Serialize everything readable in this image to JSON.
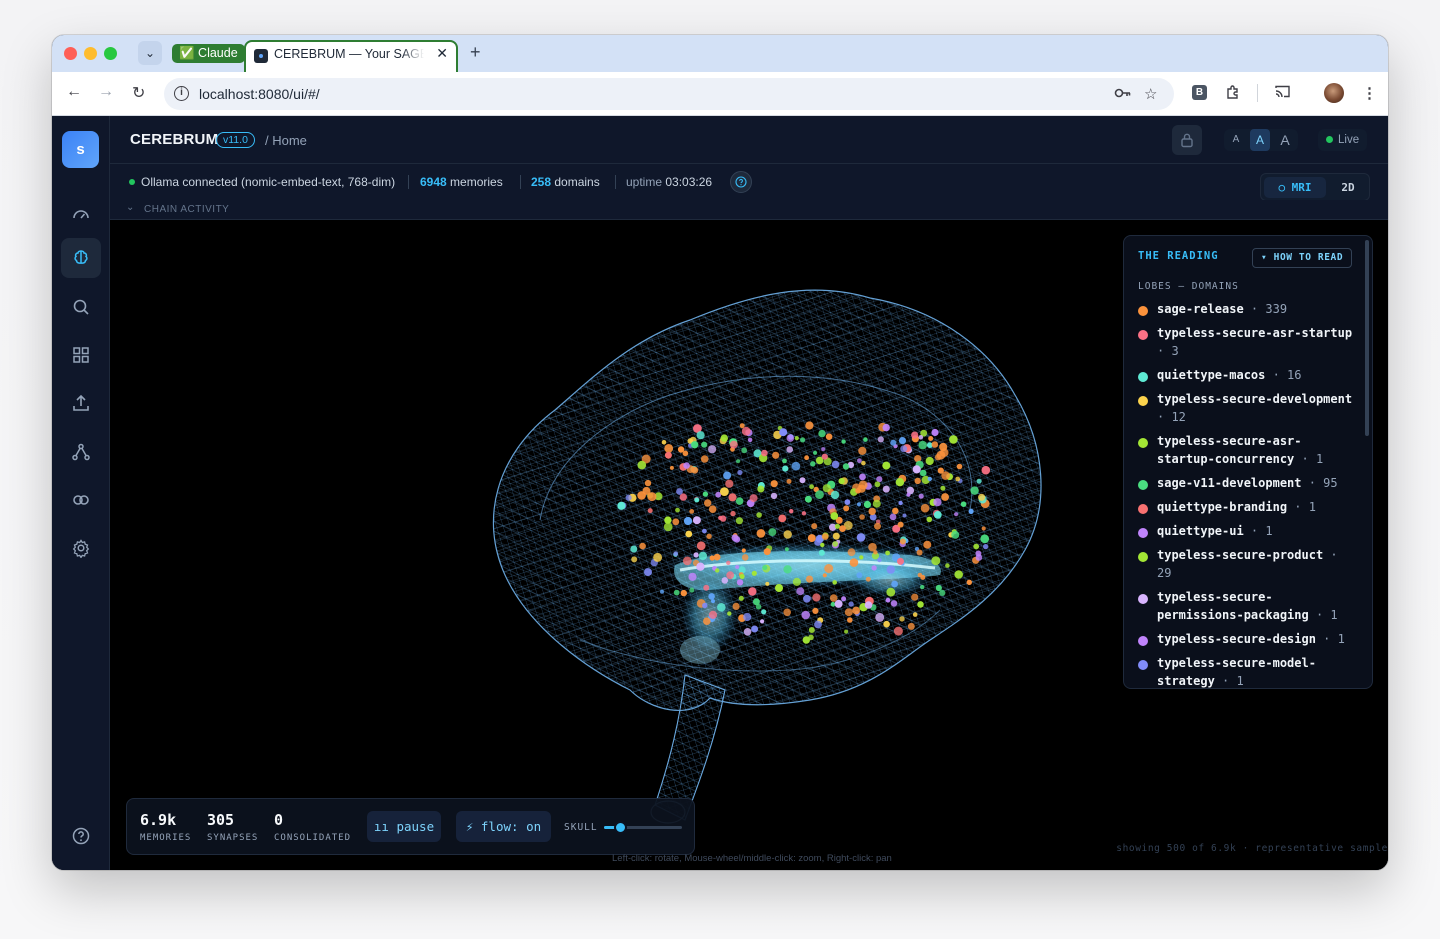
{
  "browser": {
    "claude_chip": "✅ Claude",
    "tab_title": "CEREBRUM — Your SAGE Brain",
    "url": "localhost:8080/ui/#/",
    "extension_letter": "B"
  },
  "header": {
    "logo_letter": "s",
    "app_name": "CEREBRUM",
    "version": "v11.0",
    "breadcrumb": "/ Home",
    "font_sizes": [
      "A",
      "A",
      "A"
    ],
    "live_label": "Live"
  },
  "status": {
    "ollama": "Ollama connected (nomic-embed-text, 768-dim)",
    "memories_count": "6948",
    "memories_label": "memories",
    "domains_count": "258",
    "domains_label": "domains",
    "uptime_label": "uptime",
    "uptime_value": "03:03:26",
    "chain_activity": "CHAIN ACTIVITY",
    "view_mri": "○ MRI",
    "view_2d": "2D"
  },
  "legend": {
    "title": "THE READING",
    "how_to_read": "▾ HOW TO READ",
    "subtitle": "LOBES — DOMAINS",
    "items": [
      {
        "name": "sage-release",
        "count": "339",
        "color": "#fb923c"
      },
      {
        "name": "typeless-secure-asr-startup",
        "count": "3",
        "color": "#fb7185"
      },
      {
        "name": "quiettype-macos",
        "count": "16",
        "color": "#5eead4"
      },
      {
        "name": "typeless-secure-development",
        "count": "12",
        "color": "#fcd34d"
      },
      {
        "name": "typeless-secure-asr-startup-concurrency",
        "count": "1",
        "color": "#a3e635"
      },
      {
        "name": "sage-v11-development",
        "count": "95",
        "color": "#4ade80"
      },
      {
        "name": "quiettype-branding",
        "count": "1",
        "color": "#f87171"
      },
      {
        "name": "quiettype-ui",
        "count": "1",
        "color": "#c084fc"
      },
      {
        "name": "typeless-secure-product",
        "count": "29",
        "color": "#a3e635"
      },
      {
        "name": "typeless-secure-permissions-packaging",
        "count": "1",
        "color": "#d8b4fe"
      },
      {
        "name": "typeless-secure-design",
        "count": "1",
        "color": "#c084fc"
      },
      {
        "name": "typeless-secure-model-strategy",
        "count": "1",
        "color": "#818cf8"
      }
    ]
  },
  "stats": {
    "memories_value": "6.9k",
    "memories_label": "MEMORIES",
    "synapses_value": "305",
    "synapses_label": "SYNAPSES",
    "consolidated_value": "0",
    "consolidated_label": "CONSOLIDATED",
    "pause_label": "ıı pause",
    "flow_label": "⚡ flow: on",
    "skull_label": "SKULL",
    "skull_level": 0.2
  },
  "hint": "Left-click: rotate, Mouse-wheel/middle-click: zoom, Right-click: pan",
  "sample_note": "showing 500 of 6.9k · representative sample"
}
